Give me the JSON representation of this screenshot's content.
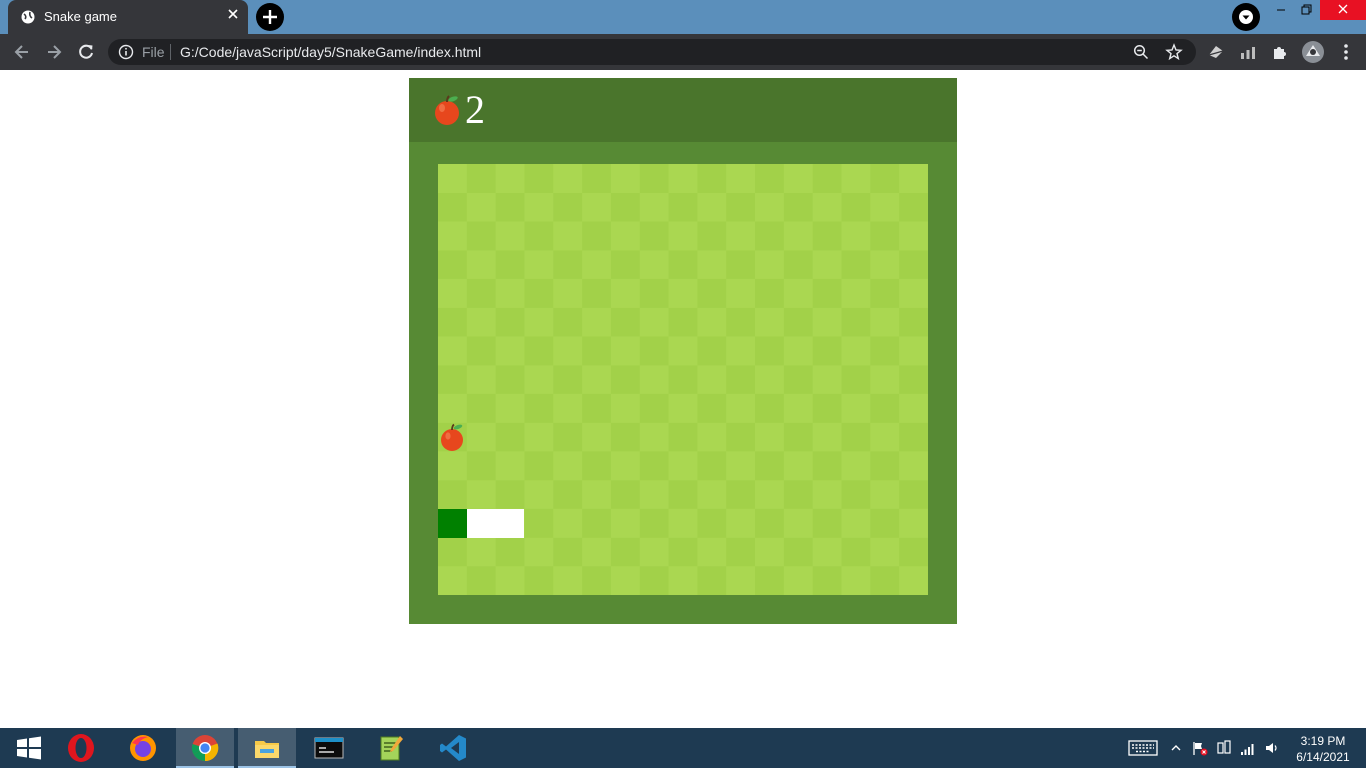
{
  "browser": {
    "tab_title": "Snake game",
    "address_scheme_label": "File",
    "address_url": "G:/Code/javaScript/day5/SnakeGame/index.html"
  },
  "game": {
    "score": "2",
    "colors": {
      "header": "#4a752c",
      "frame": "#578a34",
      "tile_light": "#aad751",
      "tile_dark": "#a2d149",
      "snake_head": "#008000",
      "snake_body": "#ffffff"
    },
    "grid": {
      "columns": 17,
      "rows": 15
    },
    "snake_cells": [
      {
        "part": "head",
        "col": 0,
        "row": 12
      },
      {
        "part": "body",
        "col": 1,
        "row": 12
      },
      {
        "part": "body",
        "col": 2,
        "row": 12
      }
    ],
    "food_cell": {
      "col": 0,
      "row": 9
    }
  },
  "taskbar": {
    "apps": [
      "opera-icon",
      "firefox-icon",
      "chrome-icon",
      "file-explorer-icon",
      "mysql-icon",
      "notepad-plus-plus-icon",
      "vscode-icon"
    ],
    "active_app": "chrome-icon",
    "time": "3:19 PM",
    "date": "6/14/2021"
  }
}
